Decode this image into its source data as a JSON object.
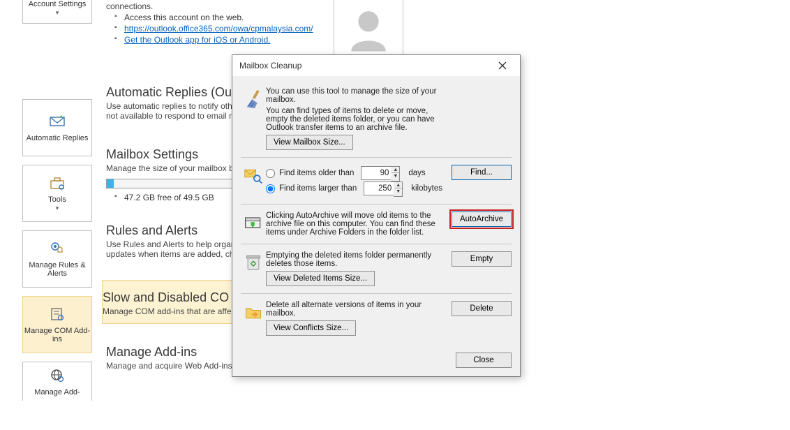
{
  "sidebar": {
    "account_settings": {
      "label": "Account Settings"
    },
    "auto_replies": {
      "label": "Automatic Replies",
      "icon": "mail-reply-icon"
    },
    "tools": {
      "label": "Tools",
      "icon": "toolbox-icon"
    },
    "rules_alerts": {
      "label": "Manage Rules & Alerts",
      "icon": "rules-bell-icon"
    },
    "com_addins": {
      "label": "Manage COM Add-ins",
      "icon": "addin-icon"
    },
    "web_addins": {
      "label": "Manage Add-",
      "icon": "globe-gear-icon"
    }
  },
  "sections": {
    "top_text": "connections.",
    "bullets": [
      {
        "text": "Access this account on the web."
      },
      {
        "text": "https://outlook.office365.com/owa/cpmalaysia.com/",
        "link": true
      },
      {
        "text": "Get the Outlook app for iOS or Android.",
        "link": true
      }
    ],
    "auto_replies": {
      "title": "Automatic Replies (Ou",
      "text": "Use automatic replies to notify oth\nnot available to respond to email m"
    },
    "mailbox_settings": {
      "title": "Mailbox Settings",
      "text": "Manage the size of your mailbox b",
      "storage_text": "47.2 GB free of 49.5 GB",
      "used_pct": 4
    },
    "rules_alerts": {
      "title": "Rules and Alerts",
      "text": "Use Rules and Alerts to help organiz\nupdates when items are added, cha"
    },
    "com_addins": {
      "title": "Slow and Disabled CO",
      "text": "Manage COM add-ins that are affe"
    },
    "web_addins": {
      "title": "Manage Add-ins",
      "text": "Manage and acquire Web Add-ins for Outlook."
    }
  },
  "dialog": {
    "title": "Mailbox Cleanup",
    "intro_line1": "You can use this tool to manage the size of your mailbox.",
    "intro_line2": "You can find types of items to delete or move, empty the deleted items folder, or you can have Outlook transfer items to an archive file.",
    "btn_view_size": "View Mailbox Size...",
    "find": {
      "older_label": "Find items older than",
      "older_value": "90",
      "older_unit": "days",
      "larger_label": "Find items larger than",
      "larger_value": "250",
      "larger_unit": "kilobytes",
      "btn": "Find..."
    },
    "archive": {
      "text": "Clicking AutoArchive will move old items to the archive file on this computer. You can find these items under Archive Folders in the folder list.",
      "btn": "AutoArchive"
    },
    "empty": {
      "text": "Emptying the deleted items folder permanently deletes those items.",
      "btn": "Empty",
      "btn_size": "View Deleted Items Size..."
    },
    "conflicts": {
      "text": "Delete all alternate versions of items in your mailbox.",
      "btn": "Delete",
      "btn_size": "View Conflicts Size..."
    },
    "btn_close": "Close"
  }
}
